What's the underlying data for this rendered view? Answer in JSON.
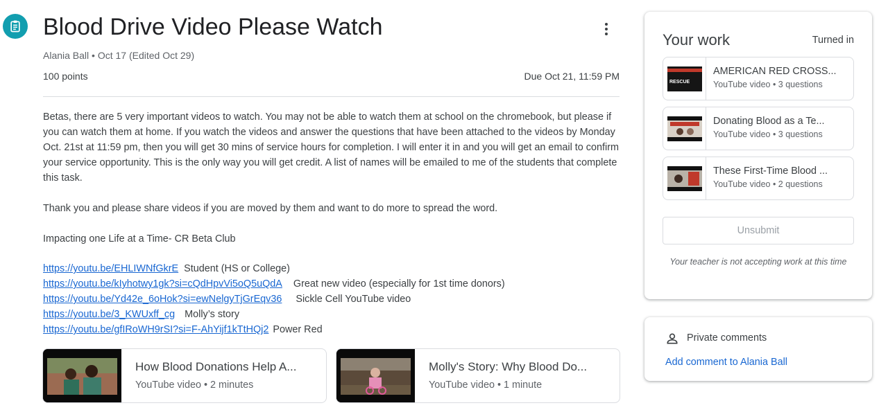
{
  "assignment": {
    "icon": "assignment-icon",
    "title": "Blood Drive Video Please Watch",
    "meta": "Alania Ball • Oct 17 (Edited Oct 29)",
    "points": "100 points",
    "due": "Due Oct 21, 11:59 PM"
  },
  "body": {
    "paragraphs": [
      "Betas, there are 5 very important videos to watch. You may not be able to watch them at school on the chromebook, but please if you can watch them at home. If you watch the videos and answer the questions that have been attached to the videos by Monday Oct. 21st at 11:59 pm, then you will get 30 mins of service hours for completion. I will enter it in and you will get an email to confirm your service opportunity. This is the only way you will get credit. A list of names will be emailed to me of the students that complete this task.",
      "Thank you and please share videos if you are moved by them and want to do more to spread the word.",
      "Impacting one Life at a Time- CR Beta Club"
    ],
    "links": [
      {
        "url": "https://youtu.be/EHLIWNfGkrE",
        "desc": "Student (HS or College)"
      },
      {
        "url": "https://youtu.be/kIyhotwy1gk?si=cQdHpvVi5oQ5uQdA",
        "desc": "Great new video (especially for 1st time donors)"
      },
      {
        "url": "https://youtu.be/Yd42e_6oHok?si=ewNelgyTjGrEqv36",
        "desc": "Sickle Cell YouTube video"
      },
      {
        "url": "https://youtu.be/3_KWUxff_cg",
        "desc": "Molly’s story"
      },
      {
        "url": "https://youtu.be/gfIRoWH9rSI?si=F-AhYijf1kTtHQj2",
        "desc": "Power Red"
      }
    ]
  },
  "attachments": [
    {
      "title": "How Blood Donations Help A...",
      "subtitle": "YouTube video • 2 minutes"
    },
    {
      "title": "Molly's Story: Why Blood Do...",
      "subtitle": "YouTube video • 1 minute"
    }
  ],
  "your_work": {
    "heading": "Your work",
    "status": "Turned in",
    "items": [
      {
        "title": "AMERICAN RED CROSS...",
        "subtitle": "YouTube video • 3 questions",
        "thumb_text": "RESCUE"
      },
      {
        "title": "Donating Blood as a Te...",
        "subtitle": "YouTube video • 3 questions"
      },
      {
        "title": "These First-Time Blood ...",
        "subtitle": "YouTube video • 2 questions"
      }
    ],
    "unsubmit_label": "Unsubmit",
    "notice": "Your teacher is not accepting work at this time"
  },
  "private_comments": {
    "icon": "person-icon",
    "label": "Private comments",
    "add_link": "Add comment to Alania Ball"
  },
  "colors": {
    "accent": "#129eaf",
    "link": "#1967d2"
  }
}
